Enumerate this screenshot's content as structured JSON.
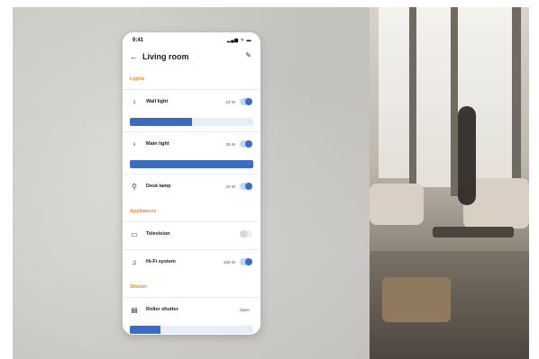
{
  "status_bar": {
    "time": "9:41",
    "system": "▂▄▆ ᯤ ▬"
  },
  "header": {
    "back": "←",
    "title": "Living room",
    "edit": "✎"
  },
  "sections": [
    {
      "title": "Lights",
      "items": [
        {
          "label": "Wall light",
          "icon": "bulb-icon",
          "icon_glyph": "♀",
          "watts": "10 W",
          "on": true,
          "level": 0.5
        },
        {
          "label": "Main light",
          "icon": "bulb-icon",
          "icon_glyph": "♀",
          "watts": "35 W",
          "on": true,
          "level": 1.0
        },
        {
          "label": "Desk lamp",
          "icon": "lamp-icon",
          "icon_glyph": "⚲",
          "watts": "20 W",
          "on": true
        }
      ]
    },
    {
      "title": "Appliances",
      "items": [
        {
          "label": "Television",
          "icon": "tv-icon",
          "icon_glyph": "▭",
          "on": false
        },
        {
          "label": "Hi-Fi system",
          "icon": "speaker-icon",
          "icon_glyph": "♫",
          "watts": "200 W",
          "on": true
        }
      ]
    },
    {
      "title": "Shutter",
      "items": [
        {
          "label": "Roller shutter",
          "icon": "shutter-icon",
          "icon_glyph": "▤",
          "status": "Open",
          "level": 0.25
        }
      ]
    }
  ],
  "colors": {
    "accent": "#3b6cc0",
    "section_title": "#f08a24"
  }
}
